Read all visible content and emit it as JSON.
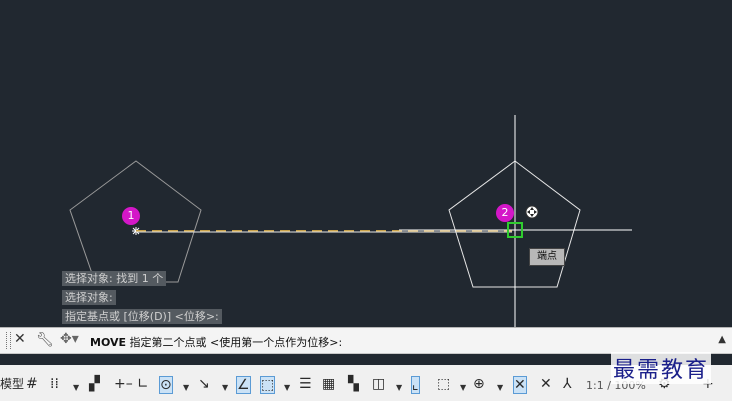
{
  "history": [
    "选择对象: 找到 1 个",
    "选择对象:",
    "指定基点或 [位移(D)] <位移>:"
  ],
  "tooltip": "端点",
  "markers": [
    "1",
    "2"
  ],
  "command": {
    "name": "MOVE",
    "prompt": " 指定第二个点或 <使用第一个点作为位移>:"
  },
  "statusbar": {
    "model_label": "模型",
    "scale": "1:1 / 100%"
  },
  "watermark": "最需教育",
  "colors": {
    "canvas": "#212830",
    "shape_white": "#e6e6e6",
    "shape_gray": "#9a9a9a",
    "rubberband": "#c8a24a",
    "snap_green": "#2fcc2f",
    "marker": "#d417c8"
  },
  "icons": [
    "close-icon",
    "wrench-icon",
    "move-icon",
    "grid-icon",
    "snap-icon",
    "ortho-icon",
    "polar-icon",
    "osnap-icon",
    "otrack-icon",
    "lineweight-icon",
    "transparency-icon",
    "selection-cycling-icon",
    "3d-osnap-icon",
    "ucs-icon",
    "gizmo-icon",
    "annotation-icon",
    "workspace-gear-icon",
    "plus-icon"
  ]
}
